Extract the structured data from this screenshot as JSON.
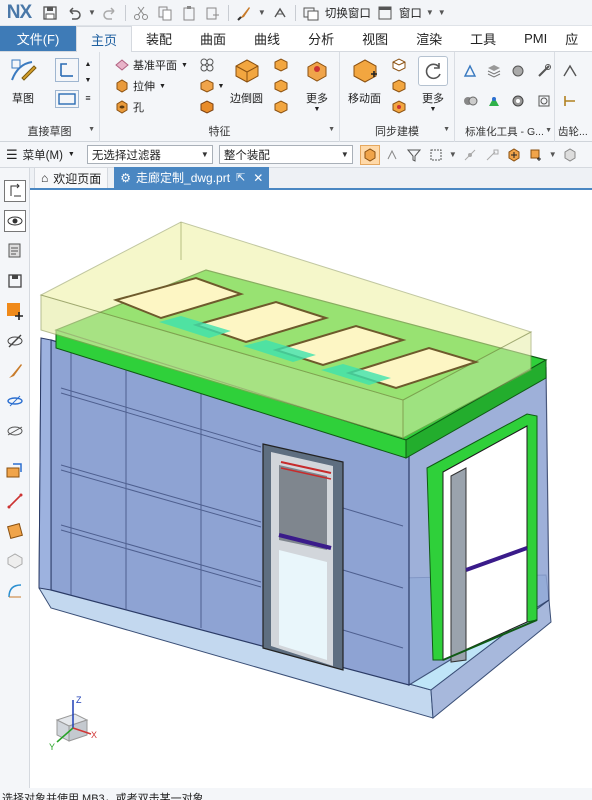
{
  "app": {
    "logo": "NX"
  },
  "quick_access": {
    "switch_window_label": "切换窗口",
    "window_label": "窗口"
  },
  "tabs": [
    {
      "label": "文件(F)",
      "active": false,
      "is_file": true
    },
    {
      "label": "主页",
      "active": true
    },
    {
      "label": "装配",
      "active": false
    },
    {
      "label": "曲面",
      "active": false
    },
    {
      "label": "曲线",
      "active": false
    },
    {
      "label": "分析",
      "active": false
    },
    {
      "label": "视图",
      "active": false
    },
    {
      "label": "渲染",
      "active": false
    },
    {
      "label": "工具",
      "active": false
    },
    {
      "label": "PMI",
      "active": false
    },
    {
      "label": "应",
      "active": false
    }
  ],
  "ribbon": {
    "direct_sketch": {
      "label": "直接草图",
      "sketch_label": "草图"
    },
    "feature": {
      "label": "特征",
      "datum_plane_label": "基准平面",
      "extrude_label": "拉伸",
      "hole_label": "孔",
      "edge_blend_label": "边倒圆",
      "more_label": "更多"
    },
    "sync_modeling": {
      "label": "同步建模",
      "move_face_label": "移动面",
      "more_label": "更多"
    },
    "std_tools": {
      "label": "标准化工具 - G..."
    },
    "gear": {
      "label": "齿轮..."
    }
  },
  "selection_bar": {
    "menu_label": "菜单(M)",
    "filter_value": "无选择过滤器",
    "scope_value": "整个装配"
  },
  "doc_tabs": {
    "welcome_label": "欢迎页面",
    "active_label": "走廊定制_dwg.prt"
  },
  "triad": {
    "x": "X",
    "y": "Y",
    "z": "Z"
  },
  "status_text": "选择对象并使用 MB3，或者双击某一对象",
  "colors": {
    "accent": "#3e7bb7",
    "doc_tab_active": "#4a87c2",
    "model_wall": "#8ea3d3",
    "model_roof": "#2fd03a",
    "model_top_glass": "#eef2a0"
  }
}
